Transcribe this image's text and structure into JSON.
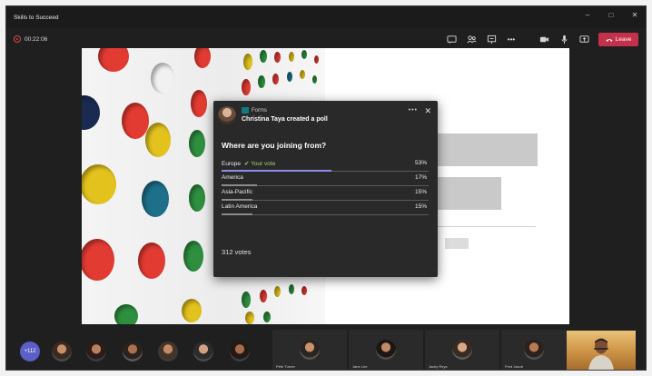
{
  "window": {
    "title": "Skills to Succeed"
  },
  "meeting": {
    "recording_time": "00:22:06",
    "leave_label": "Leave"
  },
  "toolbar_icons": [
    "chat-icon",
    "people-icon",
    "whiteboard-icon",
    "more-icon",
    "camera-icon",
    "mic-icon",
    "share-icon"
  ],
  "poll": {
    "app_name": "Forms",
    "creator_text": "Christina Taya created a poll",
    "more": "•••",
    "close": "✕",
    "question": "Where are you joining from?",
    "options": [
      {
        "label": "Europe",
        "vote_note": "✔ Your vote",
        "percent": "53%",
        "value": 53
      },
      {
        "label": "America",
        "vote_note": "",
        "percent": "17%",
        "value": 17
      },
      {
        "label": "Asia-Pacific",
        "vote_note": "",
        "percent": "15%",
        "value": 15
      },
      {
        "label": "Latin America",
        "vote_note": "",
        "percent": "15%",
        "value": 15
      }
    ],
    "votes": "312 votes"
  },
  "participants": {
    "more_count": "+112",
    "tiles": [
      "Pete Turner",
      "Jane Lee",
      "Jacky Reys",
      "Fred Jacob"
    ]
  },
  "colors": {
    "accent": "#5b5fc7",
    "leave": "#c4314b",
    "your_vote_bar": "#8b8fe8"
  }
}
